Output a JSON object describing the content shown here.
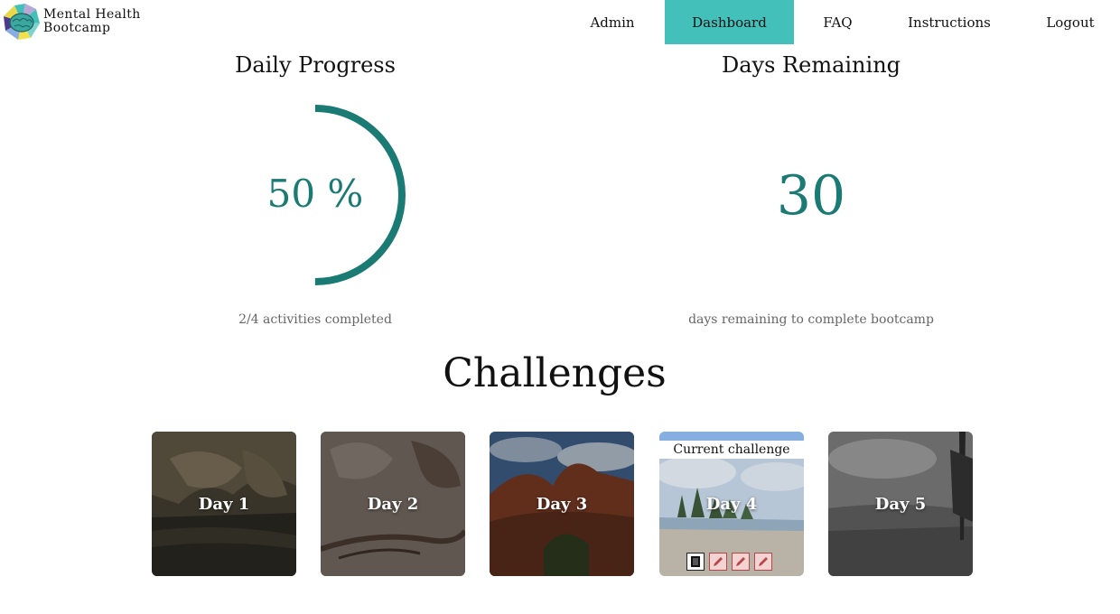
{
  "brand": {
    "line1": "Mental Health",
    "line2": "Bootcamp",
    "logo_icon": "brain-logo-icon"
  },
  "nav": {
    "items": [
      {
        "label": "Admin",
        "active": false
      },
      {
        "label": "Dashboard",
        "active": true
      },
      {
        "label": "FAQ",
        "active": false
      },
      {
        "label": "Instructions",
        "active": false
      },
      {
        "label": "Logout",
        "active": false
      }
    ],
    "active_color": "#44c0bb"
  },
  "daily_progress": {
    "title": "Daily Progress",
    "percent_text": "50 %",
    "percent": 50,
    "caption": "2/4 activities completed",
    "ring_color": "#1a7a74"
  },
  "days_remaining": {
    "title": "Days Remaining",
    "value": "30",
    "caption": "days remaining to complete bootcamp"
  },
  "challenges": {
    "title": "Challenges",
    "current_label": "Current challenge",
    "days": [
      {
        "label": "Day 1",
        "scene": "rock-pool"
      },
      {
        "label": "Day 2",
        "scene": "driftwood-sand"
      },
      {
        "label": "Day 3",
        "scene": "red-rocks"
      },
      {
        "label": "Day 4",
        "scene": "beach-trees",
        "current": true,
        "activities": [
          {
            "icon": "book-icon",
            "done": true
          },
          {
            "icon": "pencil-icon",
            "done": false
          },
          {
            "icon": "pencil-icon",
            "done": false
          },
          {
            "icon": "pencil-icon",
            "done": false
          }
        ]
      },
      {
        "label": "Day 5",
        "scene": "misty-beach"
      }
    ]
  }
}
